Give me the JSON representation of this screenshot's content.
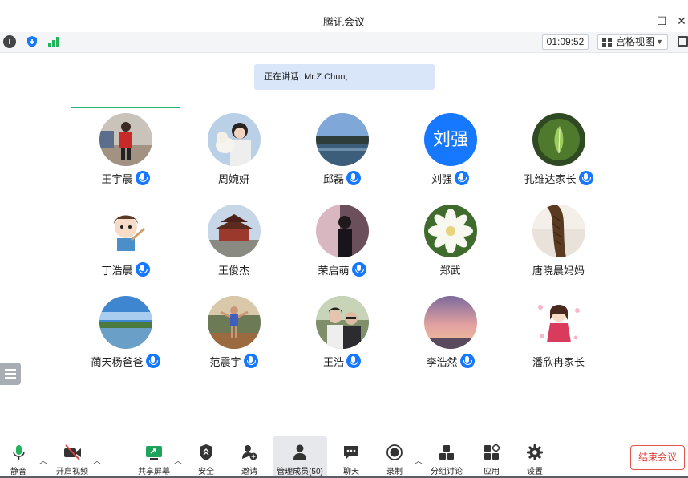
{
  "window": {
    "title": "腾讯会议"
  },
  "toolbar": {
    "timer": "01:09:52",
    "view_label": "宫格视图"
  },
  "speaking": {
    "text": "正在讲话: Mr.Z.Chun;"
  },
  "participants": [
    {
      "name": "王宇晨",
      "mic": true,
      "avatar": "photo-boy-red-jacket"
    },
    {
      "name": "周婉妍",
      "mic": false,
      "avatar": "photo-girl-with-cat"
    },
    {
      "name": "邱磊",
      "mic": true,
      "avatar": "photo-lake-landscape"
    },
    {
      "name": "刘强",
      "mic": true,
      "avatar_text": "刘强",
      "avatar_color": "#1677ff"
    },
    {
      "name": "孔维达家长",
      "mic": true,
      "avatar": "photo-green-leaf"
    },
    {
      "name": "丁浩晨",
      "mic": true,
      "avatar": "cartoon-boy"
    },
    {
      "name": "王俊杰",
      "mic": false,
      "avatar": "photo-temple"
    },
    {
      "name": "荣启萌",
      "mic": true,
      "avatar": "photo-dark-figure"
    },
    {
      "name": "郑武",
      "mic": false,
      "avatar": "photo-white-flower"
    },
    {
      "name": "唐晓晨妈妈",
      "mic": false,
      "avatar": "photo-braid"
    },
    {
      "name": "蔺天杨爸爸",
      "mic": true,
      "avatar": "photo-lake-sky"
    },
    {
      "name": "范震宇",
      "mic": true,
      "avatar": "photo-runner"
    },
    {
      "name": "王浩",
      "mic": true,
      "avatar": "photo-two-people"
    },
    {
      "name": "李浩然",
      "mic": true,
      "avatar": "photo-sunset"
    },
    {
      "name": "潘欣冉家长",
      "mic": false,
      "avatar": "cartoon-girl"
    }
  ],
  "bottombar": {
    "mute": "静音",
    "video": "开启视频",
    "share": "共享屏幕",
    "security": "安全",
    "invite": "邀请",
    "members": "管理成员(50)",
    "chat": "聊天",
    "record": "录制",
    "breakout": "分组讨论",
    "apps": "应用",
    "settings": "设置",
    "end": "结束会议"
  },
  "colors": {
    "accent": "#1677ff",
    "active_speaker": "#27b36b",
    "end": "#e2413b"
  }
}
